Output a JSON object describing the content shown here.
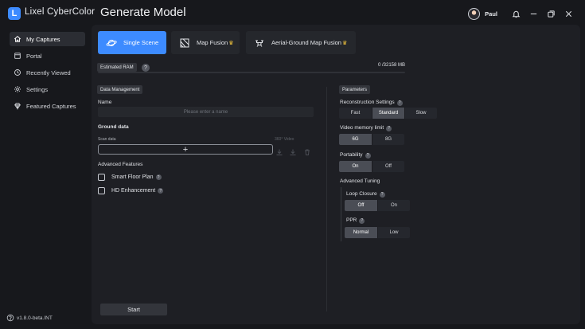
{
  "app": {
    "name": "Lixel CyberColor",
    "logo_letter": "L",
    "page_title": "Generate Model",
    "user_name": "Paul",
    "version": "v1.8.0-beta.INT"
  },
  "sidebar": {
    "items": [
      {
        "label": "My Captures",
        "icon": "home-icon",
        "active": true
      },
      {
        "label": "Portal",
        "icon": "portal-icon",
        "active": false
      },
      {
        "label": "Recently Viewed",
        "icon": "history-icon",
        "active": false
      },
      {
        "label": "Settings",
        "icon": "gear-icon",
        "active": false
      },
      {
        "label": "Featured Captures",
        "icon": "diamond-icon",
        "active": false
      }
    ]
  },
  "tabs": [
    {
      "label": "Single Scene",
      "icon": "planet-icon",
      "active": true,
      "premium": false
    },
    {
      "label": "Map Fusion",
      "icon": "map-fusion-icon",
      "active": false,
      "premium": true
    },
    {
      "label": "Aerial-Ground Map Fusion",
      "icon": "drone-icon",
      "active": false,
      "premium": true
    }
  ],
  "ram": {
    "label": "Estimated RAM",
    "value_text": "0 /32158 MB",
    "fraction_used": 0
  },
  "data_management": {
    "section_chip": "Data Management",
    "name_label": "Name",
    "name_placeholder": "Please enter a name",
    "name_value": "",
    "ground_data_label": "Ground data",
    "scan_data_label": "Scan data",
    "video_label": "360° Video",
    "add_symbol": "+"
  },
  "advanced_features": {
    "label": "Advanced Features",
    "options": [
      {
        "label": "Smart Floor Plan",
        "checked": false
      },
      {
        "label": "HD Enhancement",
        "checked": false
      }
    ]
  },
  "parameters": {
    "section_chip": "Parameters",
    "reconstruction": {
      "label": "Reconstruction Settings",
      "options": [
        "Fast",
        "Standard",
        "Slow"
      ],
      "selected": "Standard"
    },
    "video_memory": {
      "label": "Video memory limit",
      "options": [
        "6G",
        "8G"
      ],
      "selected": "6G"
    },
    "portability": {
      "label": "Portability",
      "options": [
        "On",
        "Off"
      ],
      "selected": "On"
    },
    "advanced_tuning_label": "Advanced Tuning",
    "loop_closure": {
      "label": "Loop Closure",
      "options": [
        "Off",
        "On"
      ],
      "selected": "Off"
    },
    "ppr": {
      "label": "PPR",
      "options": [
        "Normal",
        "Low"
      ],
      "selected": "Normal"
    }
  },
  "start_label": "Start",
  "help_symbol": "?",
  "colors": {
    "accent": "#3d8bff",
    "background": "#17181c",
    "panel": "#1e1f24",
    "premium": "#f0c33c"
  }
}
